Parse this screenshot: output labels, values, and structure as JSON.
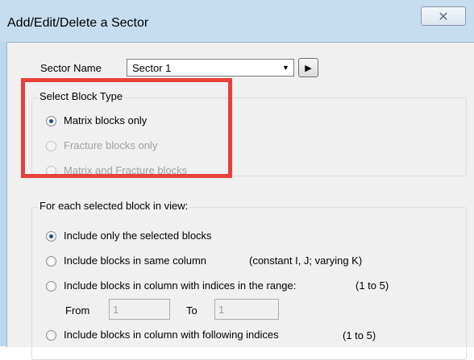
{
  "window": {
    "title": "Add/Edit/Delete a Sector",
    "close_glyph": "✕"
  },
  "sector": {
    "label": "Sector Name",
    "value": "Sector 1",
    "dropdown_icon": "chevron-down-icon",
    "next_icon": "play-arrow-icon"
  },
  "block_type": {
    "legend": "Select Block Type",
    "options": [
      {
        "label": "Matrix blocks only",
        "checked": true,
        "enabled": true
      },
      {
        "label": "Fracture blocks only",
        "checked": false,
        "enabled": false
      },
      {
        "label": "Matrix and Fracture blocks",
        "checked": false,
        "enabled": false
      }
    ]
  },
  "selection": {
    "legend": "For each selected block in view:",
    "options": [
      {
        "label": "Include only the selected blocks",
        "checked": true
      },
      {
        "label": "Include blocks in same column",
        "note": "(constant I, J; varying K)",
        "checked": false
      },
      {
        "label": "Include blocks in column with indices in the range:",
        "note": "(1 to 5)",
        "checked": false
      },
      {
        "label": "Include blocks in column with following indices",
        "note": "(1 to 5)",
        "checked": false
      }
    ],
    "from_label": "From",
    "from_value": "1",
    "to_label": "To",
    "to_value": "1"
  },
  "colors": {
    "highlight": "#e8403b",
    "title_bar": "#c6ddf0",
    "dialog_bg": "#f0f0f0"
  }
}
